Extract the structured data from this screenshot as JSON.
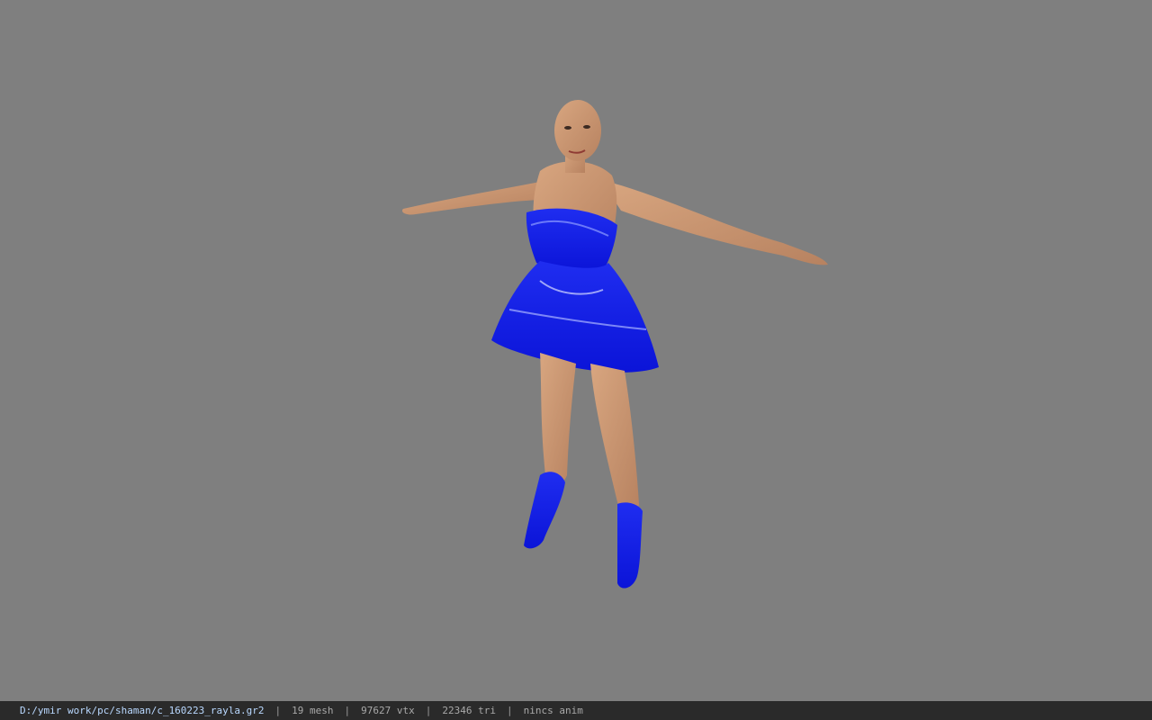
{
  "viewport": {
    "background_color": "#7f7f7f",
    "model_name_icon": "character-model-icon"
  },
  "statusbar": {
    "file_path": "D:/ymir work/pc/shaman/c_160223_rayla.gr2",
    "separator": "|",
    "mesh_count": "19 mesh",
    "vertex_count": "97627 vtx",
    "triangle_count": "22346 tri",
    "animation": "nincs anim"
  }
}
